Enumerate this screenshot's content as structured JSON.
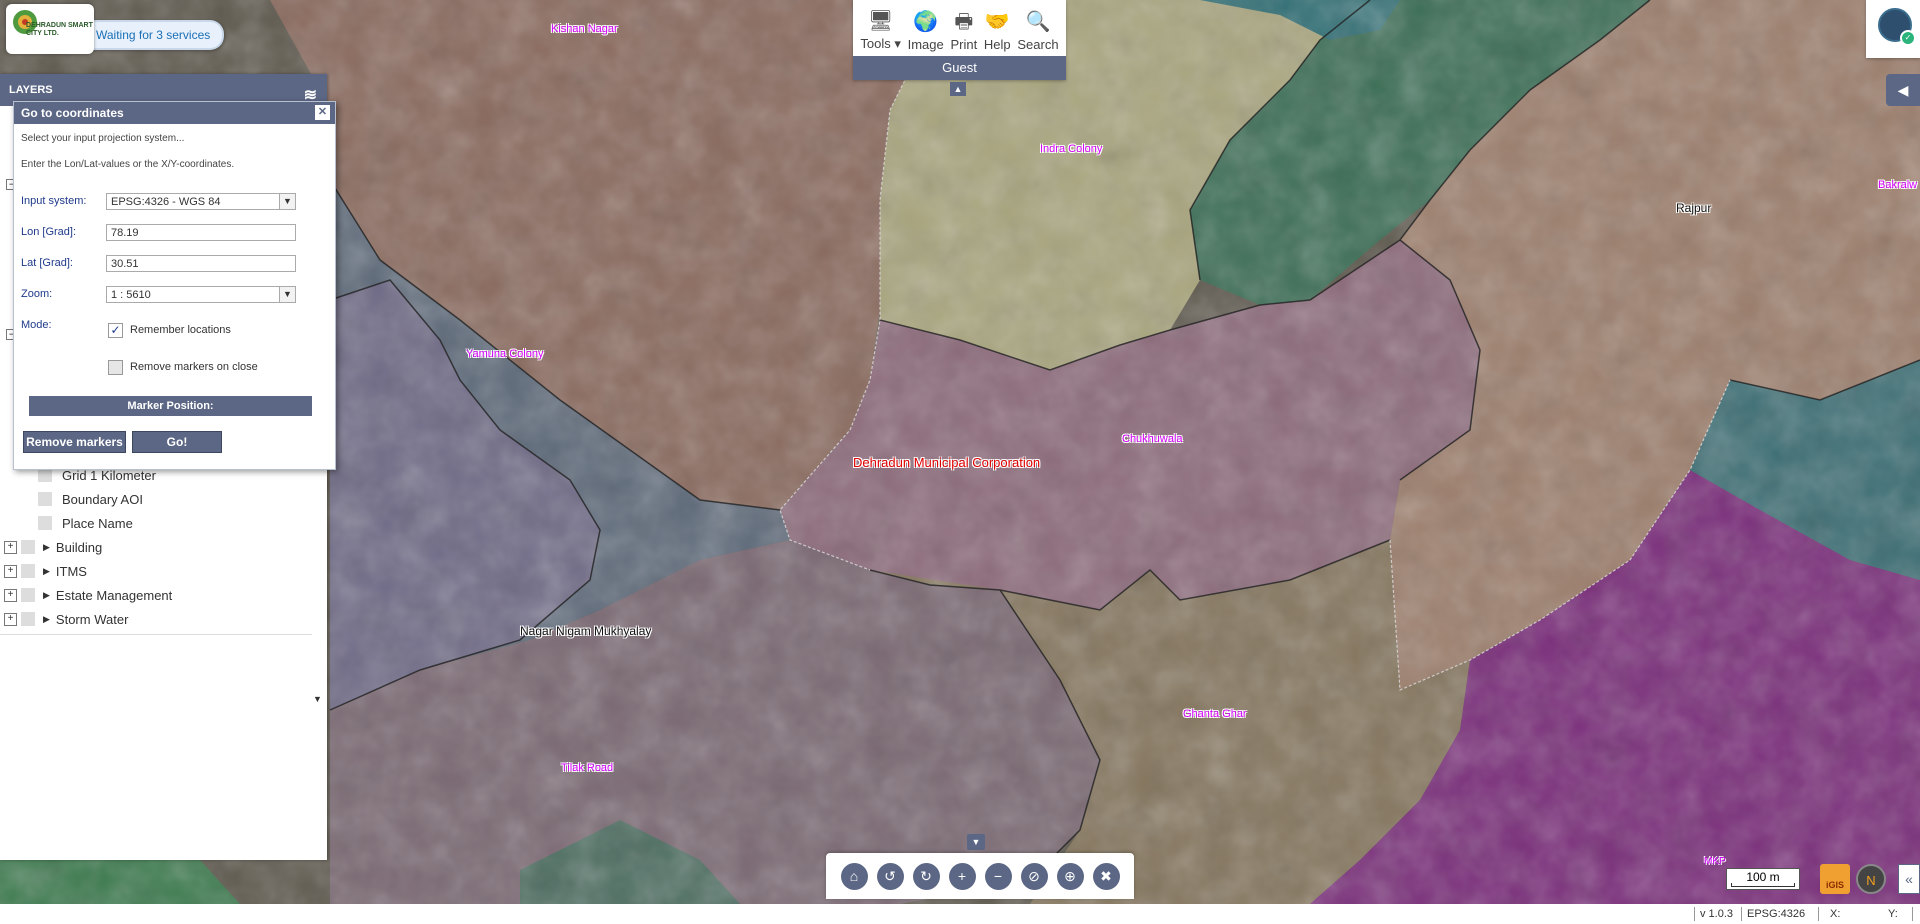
{
  "app": {
    "logo_text": "DEHRADUN SMART CITY LTD.",
    "status_message": "Waiting for 3 services"
  },
  "toolbar": {
    "items": [
      {
        "label": "Tools",
        "icon": "monitor-icon",
        "glyph": "🖥"
      },
      {
        "label": "Image",
        "icon": "globe-icon",
        "glyph": "🌍"
      },
      {
        "label": "Print",
        "icon": "printer-icon",
        "glyph": "🖶"
      },
      {
        "label": "Help",
        "icon": "handshake-icon",
        "glyph": "🤝"
      },
      {
        "label": "Search",
        "icon": "search-icon",
        "glyph": "🔍"
      }
    ],
    "tools_caret": "▾",
    "user_label": "Guest"
  },
  "layers_panel": {
    "title": "LAYERS",
    "items": [
      {
        "label": "Grid 1 Kilometer",
        "kind": "child"
      },
      {
        "label": "Boundary AOI",
        "kind": "child"
      },
      {
        "label": "Place Name",
        "kind": "child"
      },
      {
        "label": "Building",
        "kind": "group"
      },
      {
        "label": "ITMS",
        "kind": "group"
      },
      {
        "label": "Estate Management",
        "kind": "group"
      },
      {
        "label": "Storm Water",
        "kind": "group"
      }
    ]
  },
  "goto_dialog": {
    "title": "Go to coordinates",
    "hint1": "Select your input projection system...",
    "hint2": "Enter the Lon/Lat-values or the X/Y-coordinates.",
    "input_system_label": "Input system:",
    "input_system_value": "EPSG:4326 - WGS 84",
    "lon_label": "Lon [Grad]:",
    "lon_value": "78.19",
    "lat_label": "Lat [Grad]:",
    "lat_value": "30.51",
    "zoom_label": "Zoom:",
    "zoom_value": "1 : 5610",
    "mode_label": "Mode:",
    "remember_label": "Remember locations",
    "remember_checked": true,
    "remove_on_close_label": "Remove markers on close",
    "remove_on_close_checked": false,
    "marker_position_label": "Marker Position:",
    "remove_markers_button": "Remove markers",
    "go_button": "Go!"
  },
  "map": {
    "place_labels": [
      {
        "text": "Kishan Nagar",
        "style": "magenta"
      },
      {
        "text": "Indra Colony",
        "style": "magenta"
      },
      {
        "text": "Rajpur",
        "style": "black"
      },
      {
        "text": "Bakralw",
        "style": "magenta"
      },
      {
        "text": "Yamuna Colony",
        "style": "magenta"
      },
      {
        "text": "Chukhuwala",
        "style": "magenta"
      },
      {
        "text": "Dehradun Municipal Corporation",
        "style": "red"
      },
      {
        "text": "Nagar Nigam Mukhyalay",
        "style": "black"
      },
      {
        "text": "Ghanta Ghar",
        "style": "magenta"
      },
      {
        "text": "Tilak Road",
        "style": "magenta"
      }
    ],
    "zone_colors": [
      "#8a6a5e",
      "#a9a57e",
      "#3c6e56",
      "#9c7e6c",
      "#8c6a7a",
      "#5e6a7a",
      "#6f6a86",
      "#85765e",
      "#7a2e7a",
      "#3c6e74"
    ],
    "scale_label": "100 m",
    "extra_label": "MKP",
    "igis_label": "iGIS",
    "compass_label": "N"
  },
  "nav_controls": [
    "home-icon",
    "undo-icon",
    "redo-icon",
    "zoom-in-icon",
    "zoom-out-icon",
    "hide-icon",
    "locate-icon",
    "clear-icon"
  ],
  "status_bar": {
    "version": "v 1.0.3",
    "projection": "EPSG:4326",
    "x_label": "X:",
    "y_label": "Y:"
  }
}
